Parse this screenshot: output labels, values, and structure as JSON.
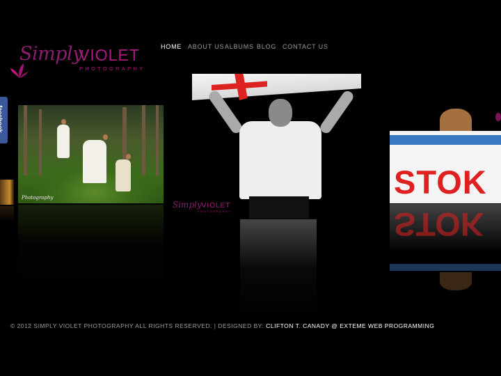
{
  "logo": {
    "script": "Simply",
    "word": "VIOLET",
    "sub": "PHOTOGRAPHY"
  },
  "nav": {
    "items": [
      {
        "label": "HOME",
        "active": true
      },
      {
        "label": "ABOUT US"
      },
      {
        "label": "ALBUMS"
      },
      {
        "label": "BLOG"
      },
      {
        "label": "CONTACT US"
      }
    ]
  },
  "facebook_tab": {
    "label": "facebook"
  },
  "gallery": {
    "photo1_watermark": "Photography",
    "photo2_watermark": {
      "script": "Simply",
      "word": "VIOLET",
      "sub": "PHOTOGRAPHY"
    },
    "photo3_sign_text": "STOK"
  },
  "footer": {
    "copyright": "© 2012 SIMPLY VIOLET PHOTOGRAPHY ALL RIGHTS RESERVED. | DESIGNED BY:",
    "credit": "CLIFTON T. CANADY @ EXTEME WEB PROGRAMMING"
  },
  "colors": {
    "brand": "#b01983",
    "background": "#000000",
    "facebook": "#3b5998"
  }
}
